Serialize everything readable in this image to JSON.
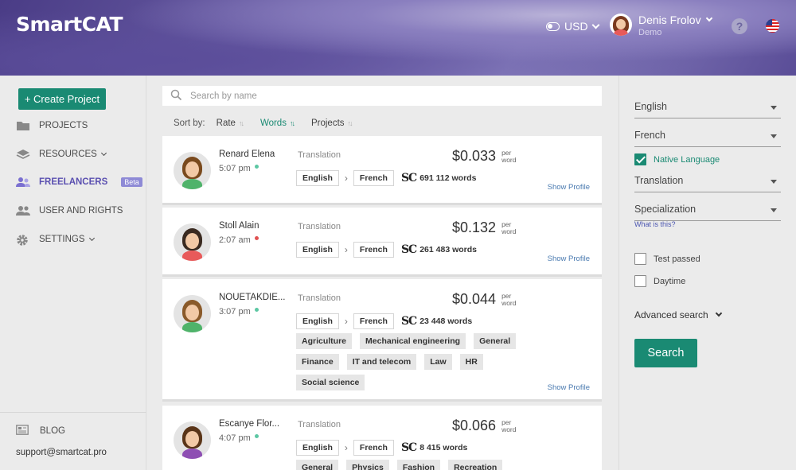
{
  "header": {
    "logo": "SmartCAT",
    "currency": "USD",
    "user_name": "Denis Frolov",
    "user_role": "Demo"
  },
  "sidebar": {
    "create_project": "+ Create Project",
    "items": [
      {
        "label": "PROJECTS",
        "icon": "folder-icon"
      },
      {
        "label": "RESOURCES",
        "icon": "stack-icon",
        "dropdown": true
      },
      {
        "label": "FREELANCERS",
        "icon": "people-icon",
        "badge": "Beta",
        "active": true
      },
      {
        "label": "USER AND RIGHTS",
        "icon": "users-icon"
      },
      {
        "label": "SETTINGS",
        "icon": "gear-icon",
        "dropdown": true
      }
    ],
    "blog": "BLOG",
    "support": "support@smartcat.pro"
  },
  "main": {
    "search_placeholder": "Search by name",
    "sort_by": "Sort by:",
    "sort_options": [
      "Rate",
      "Words",
      "Projects"
    ],
    "sort_active": "Words"
  },
  "freelancers": [
    {
      "name": "Renard Elena",
      "time": "5:07 pm",
      "status_color": "#5cc7a3",
      "service": "Translation",
      "price": "$0.033",
      "per": "per",
      "unit": "word",
      "from": "English",
      "to": "French",
      "words": "691 112 words",
      "tags": [],
      "show_profile": "Show Profile",
      "hair": "#7a4a1e",
      "shirt": "#4fb36a"
    },
    {
      "name": "Stoll Alain",
      "time": "2:07 am",
      "status_color": "#e05252",
      "service": "Translation",
      "price": "$0.132",
      "per": "per",
      "unit": "word",
      "from": "English",
      "to": "French",
      "words": "261 483 words",
      "tags": [],
      "show_profile": "Show Profile",
      "hair": "#3a2a20",
      "shirt": "#e85a5a"
    },
    {
      "name": "NOUETAKDIE...",
      "time": "3:07 pm",
      "status_color": "#5cc7a3",
      "service": "Translation",
      "price": "$0.044",
      "per": "per",
      "unit": "word",
      "from": "English",
      "to": "French",
      "words": "23 448 words",
      "tags": [
        "Agriculture",
        "Mechanical engineering",
        "General",
        "Finance",
        "IT and telecom",
        "Law",
        "HR",
        "Social science"
      ],
      "show_profile": "Show Profile",
      "hair": "#8a5a2a",
      "shirt": "#4fb36a"
    },
    {
      "name": "Escanye Flor...",
      "time": "4:07 pm",
      "status_color": "#5cc7a3",
      "service": "Translation",
      "price": "$0.066",
      "per": "per",
      "unit": "word",
      "from": "English",
      "to": "French",
      "words": "8 415 words",
      "tags": [
        "General",
        "Physics",
        "Fashion",
        "Recreation"
      ],
      "show_profile": "",
      "hair": "#5a3518",
      "shirt": "#8e4fb3"
    }
  ],
  "filters": {
    "source_lang": "English",
    "target_lang": "French",
    "native_language": "Native Language",
    "service": "Translation",
    "specialization": "Specialization",
    "what_is_this": "What is this?",
    "test_passed": "Test passed",
    "daytime": "Daytime",
    "advanced_search": "Advanced search",
    "search_button": "Search"
  },
  "colors": {
    "accent": "#1a8a73",
    "active_nav": "#5a4fb0"
  }
}
